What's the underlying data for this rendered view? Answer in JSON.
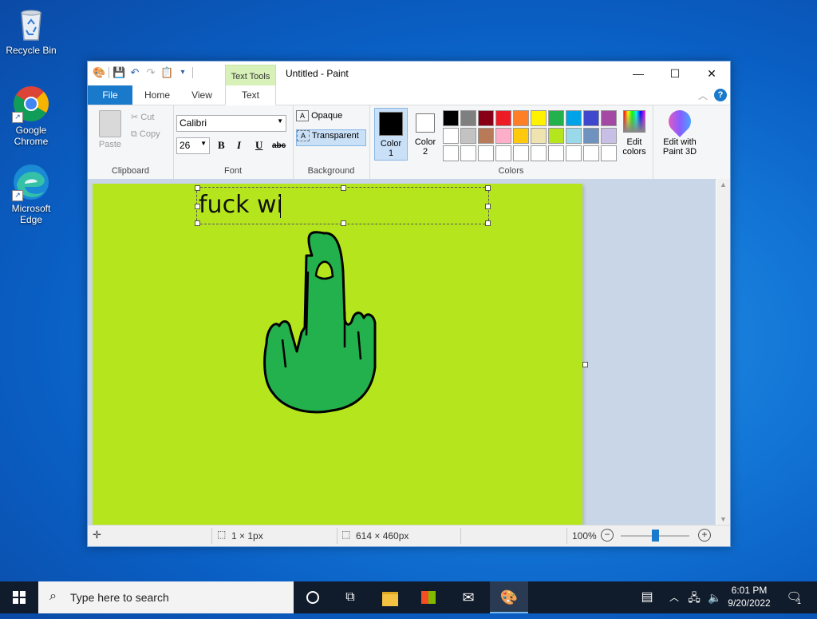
{
  "desktop": {
    "icons": [
      {
        "label": "Recycle Bin"
      },
      {
        "label": "Google Chrome"
      },
      {
        "label": "Microsoft Edge"
      }
    ]
  },
  "window": {
    "title": "Untitled - Paint",
    "contextual_tab": "Text Tools",
    "tabs": [
      "File",
      "Home",
      "View",
      "Text"
    ],
    "active_tab": "Text"
  },
  "ribbon": {
    "clipboard": {
      "label": "Clipboard",
      "paste": "Paste",
      "cut": "Cut",
      "copy": "Copy"
    },
    "font": {
      "label": "Font",
      "family": "Calibri",
      "size": "26",
      "bold": "B",
      "italic": "I",
      "underline": "U",
      "strike": "abc"
    },
    "background": {
      "label": "Background",
      "opaque": "Opaque",
      "transparent": "Transparent",
      "selected": "Transparent"
    },
    "colors": {
      "label": "Colors",
      "color1": "Color\n1",
      "color1_top": "Color",
      "color1_bot": "1",
      "color2_top": "Color",
      "color2_bot": "2",
      "color1_value": "#000000",
      "color2_value": "#ffffff",
      "palette_row1": [
        "#000000",
        "#7f7f7f",
        "#880015",
        "#ed1c24",
        "#ff7f27",
        "#fff200",
        "#22b14c",
        "#00a2e8",
        "#3f48cc",
        "#a349a4"
      ],
      "palette_row2": [
        "#ffffff",
        "#c3c3c3",
        "#b97a57",
        "#ffaec9",
        "#ffc90e",
        "#efe4b0",
        "#b5e61d",
        "#99d9ea",
        "#7092be",
        "#c8bfe7"
      ],
      "edit_colors_top": "Edit",
      "edit_colors_bot": "colors"
    },
    "paint3d": {
      "top": "Edit with",
      "bot": "Paint 3D"
    }
  },
  "canvas": {
    "background_color": "#b5e61d",
    "text_box_content": "fuck wi",
    "hand_fill": "#22b14c"
  },
  "status": {
    "selection_size": "1 × 1px",
    "image_size": "614 × 460px",
    "zoom": "100%",
    "zoom_level": 0.5
  },
  "taskbar": {
    "search_placeholder": "Type here to search",
    "time": "6:01 PM",
    "date": "9/20/2022",
    "notification_count": "1"
  }
}
